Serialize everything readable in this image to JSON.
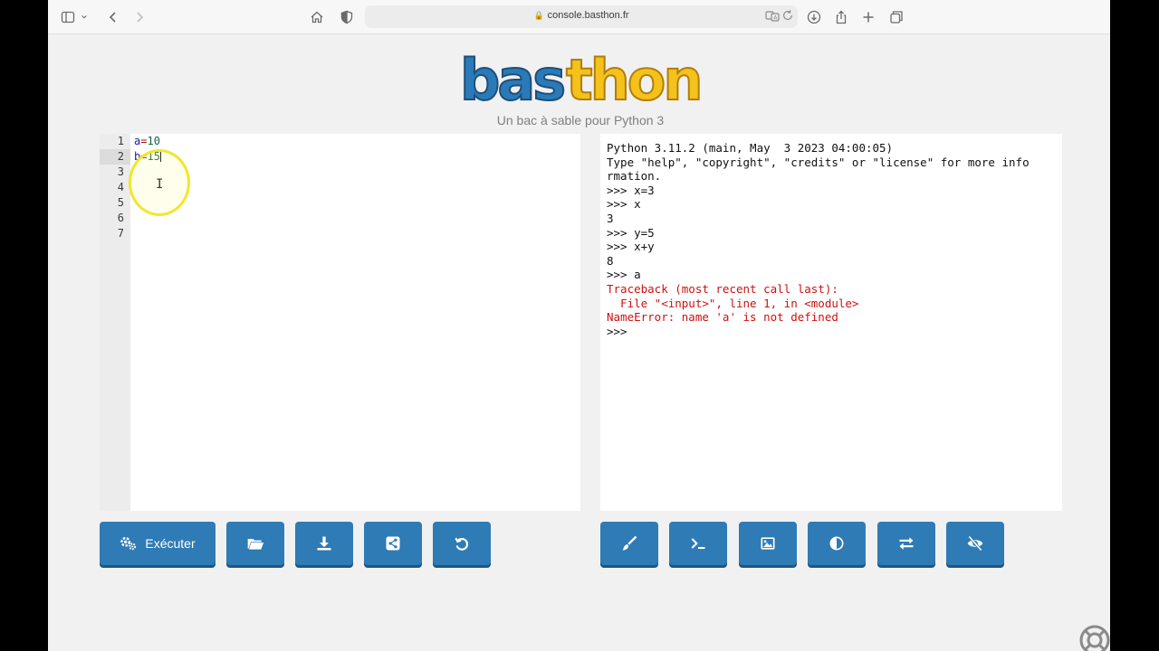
{
  "browser": {
    "url": "console.basthon.fr",
    "icons": [
      "sidebar-icon",
      "chevron-down-icon",
      "back-icon",
      "forward-icon",
      "home-icon",
      "shield-icon",
      "translate-icon",
      "reload-icon",
      "download-icon",
      "share-icon",
      "new-tab-icon",
      "tabs-icon"
    ]
  },
  "header": {
    "logo_text": "basthon",
    "subtitle": "Un bac à sable pour Python 3"
  },
  "editor": {
    "line_numbers": [
      "1",
      "2",
      "3",
      "4",
      "5",
      "6",
      "7"
    ],
    "active_line": 2,
    "lines": [
      {
        "var": "a",
        "op": "=",
        "num": "10"
      },
      {
        "var": "b",
        "op": "=",
        "num": "15"
      }
    ],
    "cursor_glyph": "I"
  },
  "console": {
    "lines": [
      {
        "text": "Python 3.11.2 (main, May  3 2023 04:00:05)",
        "error": false
      },
      {
        "text": "Type \"help\", \"copyright\", \"credits\" or \"license\" for more info",
        "error": false
      },
      {
        "text": "rmation.",
        "error": false
      },
      {
        "text": ">>> x=3",
        "error": false
      },
      {
        "text": ">>> x",
        "error": false
      },
      {
        "text": "3",
        "error": false
      },
      {
        "text": ">>> y=5",
        "error": false
      },
      {
        "text": ">>> x+y",
        "error": false
      },
      {
        "text": "8",
        "error": false
      },
      {
        "text": ">>> a",
        "error": false
      },
      {
        "text": "Traceback (most recent call last):",
        "error": true
      },
      {
        "text": "  File \"<input>\", line 1, in <module>",
        "error": true
      },
      {
        "text": "NameError: name 'a' is not defined",
        "error": true
      },
      {
        "text": ">>>",
        "error": false
      }
    ]
  },
  "buttons": {
    "run_label": "Exécuter",
    "left": [
      "run-icon",
      "open-folder-icon",
      "download-icon",
      "share-icon",
      "undo-icon"
    ],
    "right": [
      "brush-icon",
      "terminal-icon",
      "image-icon",
      "contrast-icon",
      "swap-icon",
      "eye-slash-icon"
    ]
  },
  "colors": {
    "accent": "#2f7bb5",
    "error": "#cc1111",
    "logo_blue": "#2a7ab8",
    "logo_yellow": "#f4c21a",
    "highlight": "#f0e72b"
  }
}
